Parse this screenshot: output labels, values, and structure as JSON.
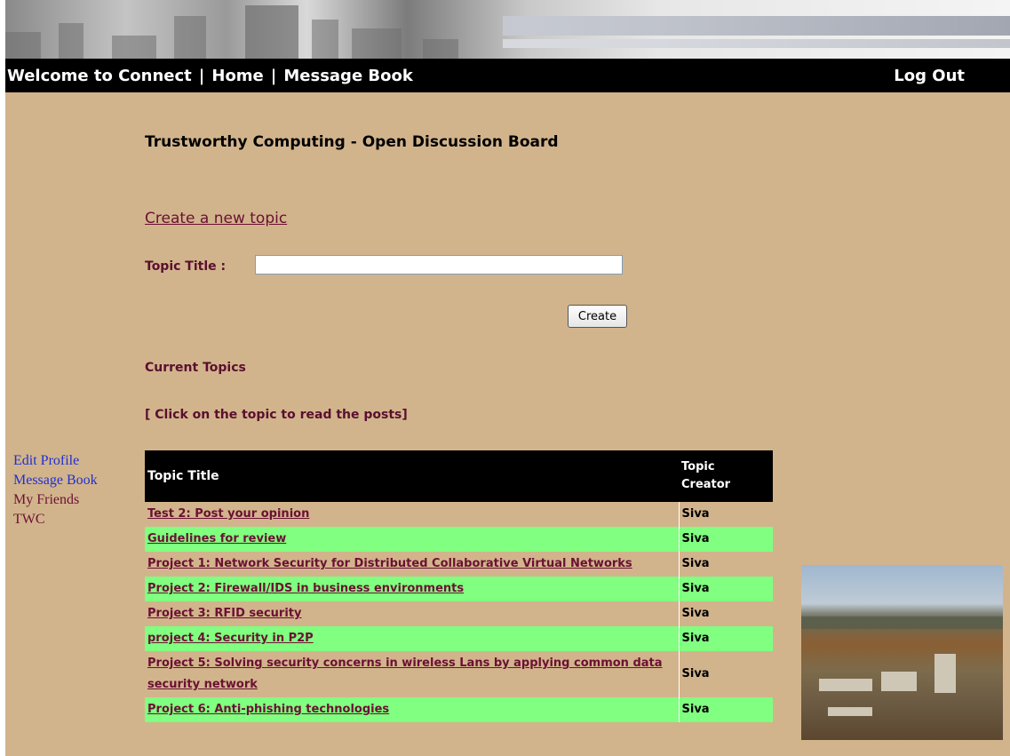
{
  "nav": {
    "welcome": "Welcome to Connect",
    "separator": "|",
    "home": "Home",
    "message_book": "Message Book",
    "logout": "Log Out"
  },
  "board": {
    "title": "Trustworthy Computing - Open Discussion Board",
    "create_link": "Create a new topic",
    "topic_title_label": "Topic Title :",
    "topic_title_value": "",
    "create_button": "Create",
    "current_topics": "Current Topics",
    "instructions": "[ Click on the topic to read the posts]"
  },
  "sidebar": {
    "items": [
      {
        "label": "Edit Profile",
        "color": "#1f2fd2"
      },
      {
        "label": "Message Book",
        "color": "#1f2fd2"
      },
      {
        "label": "My Friends",
        "color": "#6b1033"
      },
      {
        "label": "TWC",
        "color": "#6b1033"
      }
    ]
  },
  "table": {
    "headers": {
      "title": "Topic Title",
      "creator_line1": "Topic",
      "creator_line2": "Creator"
    },
    "rows": [
      {
        "title": "Test 2: Post your opinion",
        "creator": "Siva",
        "bg": "tan"
      },
      {
        "title": "Guidelines for review",
        "creator": "Siva",
        "bg": "green"
      },
      {
        "title": "Project 1: Network Security for Distributed Collaborative Virtual Networks",
        "creator": "Siva",
        "bg": "tan"
      },
      {
        "title": "Project 2: Firewall/IDS in business environments",
        "creator": "Siva",
        "bg": "green"
      },
      {
        "title": "Project 3: RFID security",
        "creator": "Siva",
        "bg": "tan"
      },
      {
        "title": "project 4: Security in P2P",
        "creator": "Siva",
        "bg": "green"
      },
      {
        "title": "Project 5: Solving security concerns in wireless Lans by applying common data security network",
        "creator": "Siva",
        "bg": "tan"
      },
      {
        "title": "Project 6: Anti-phishing technologies",
        "creator": "Siva",
        "bg": "green"
      }
    ]
  },
  "colors": {
    "page_bg": "#d2b48c",
    "nav_bg": "#000000",
    "link_color": "#6b1033",
    "row_highlight": "#80ff80"
  }
}
